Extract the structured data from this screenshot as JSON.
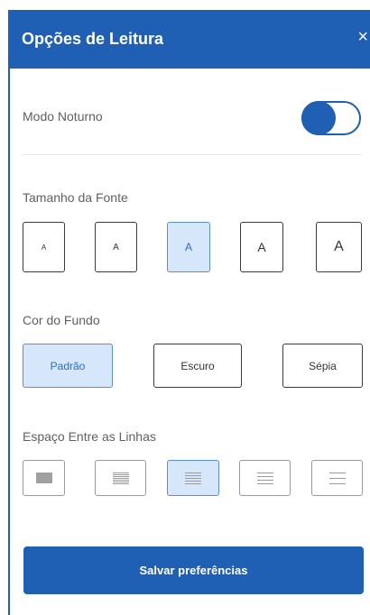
{
  "header": {
    "title": "Opções de Leitura",
    "close": "×"
  },
  "night_mode": {
    "label": "Modo Noturno",
    "on": true
  },
  "font_size": {
    "label": "Tamanho da Fonte",
    "options": [
      "A",
      "A",
      "A",
      "A",
      "A"
    ],
    "selected_index": 2
  },
  "background": {
    "label": "Cor do Fundo",
    "options": [
      "Padrão",
      "Escuro",
      "Sépia"
    ],
    "selected_index": 0
  },
  "line_spacing": {
    "label": "Espaço Entre as Linhas",
    "selected_index": 2
  },
  "save_label": "Salvar preferências",
  "colors": {
    "primary": "#1f5fb4",
    "selected_bg": "#d6e7fb"
  }
}
